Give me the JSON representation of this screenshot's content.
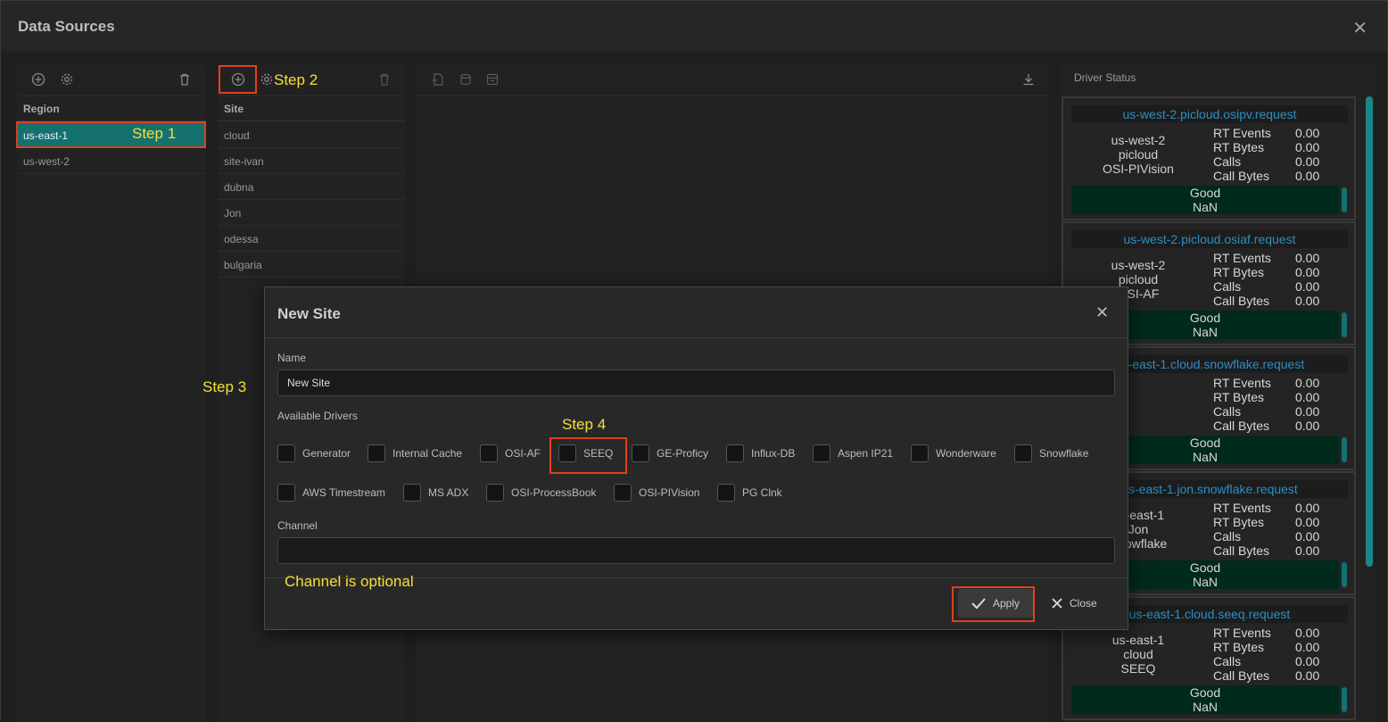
{
  "window": {
    "title": "Data Sources",
    "close_glyph": "✕"
  },
  "region_panel": {
    "header": "Region",
    "rows": [
      "us-east-1",
      "us-west-2"
    ],
    "selected": "us-east-1"
  },
  "site_panel": {
    "header": "Site",
    "rows": [
      "cloud",
      "site-ivan",
      "dubna",
      "Jon",
      "odessa",
      "bulgaria"
    ]
  },
  "annotations": {
    "step1": "Step 1",
    "step2": "Step 2",
    "step3": "Step 3",
    "step4": "Step 4",
    "channel_note": "Channel is optional"
  },
  "driver_status": {
    "header": "Driver Status",
    "stat_labels": [
      "RT Events",
      "RT Bytes",
      "Calls",
      "Call Bytes"
    ],
    "cards": [
      {
        "title": "us-west-2.picloud.osipv.request",
        "meta": [
          "us-west-2",
          "picloud",
          "OSI-PIVision"
        ],
        "values": [
          "0.00",
          "0.00",
          "0.00",
          "0.00"
        ],
        "status": "Good",
        "sub": "NaN"
      },
      {
        "title": "us-west-2.picloud.osiaf.request",
        "meta": [
          "us-west-2",
          "picloud",
          "OSI-AF"
        ],
        "values": [
          "0.00",
          "0.00",
          "0.00",
          "0.00"
        ],
        "status": "Good",
        "sub": "NaN"
      },
      {
        "title": "us-east-1.cloud.snowflake.request",
        "meta": [
          "",
          "",
          ""
        ],
        "values": [
          "0.00",
          "0.00",
          "0.00",
          "0.00"
        ],
        "status": "Good",
        "sub": "NaN"
      },
      {
        "title": "us-east-1.jon.snowflake.request",
        "meta": [
          "us-east-1",
          "Jon",
          "Snowflake"
        ],
        "values": [
          "0.00",
          "0.00",
          "0.00",
          "0.00"
        ],
        "status": "Good",
        "sub": "NaN"
      },
      {
        "title": "us-east-1.cloud.seeq.request",
        "meta": [
          "us-east-1",
          "cloud",
          "SEEQ"
        ],
        "values": [
          "0.00",
          "0.00",
          "0.00",
          "0.00"
        ],
        "status": "Good",
        "sub": "NaN"
      }
    ]
  },
  "modal": {
    "title": "New Site",
    "name_label": "Name",
    "name_value": "New Site",
    "drivers_label": "Available Drivers",
    "drivers_row1": [
      "Generator",
      "Internal Cache",
      "OSI-AF",
      "SEEQ",
      "GE-Proficy",
      "Influx-DB",
      "Aspen IP21",
      "Wonderware",
      "Snowflake"
    ],
    "drivers_row2": [
      "AWS Timestream",
      "MS ADX",
      "OSI-ProcessBook",
      "OSI-PIVision",
      "PG Clnk"
    ],
    "channel_label": "Channel",
    "channel_value": "",
    "apply_label": "Apply",
    "close_label": "Close"
  },
  "colors": {
    "accent": "#157070",
    "highlight": "#e0401d",
    "annotation": "#f4e03a",
    "link": "#2a8fc4"
  }
}
